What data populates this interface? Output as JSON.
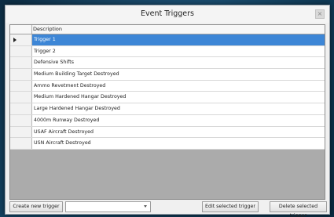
{
  "window": {
    "title": "Event Triggers",
    "close_glyph": "×"
  },
  "grid": {
    "column_header": "Description",
    "selected_index": 0,
    "rows": [
      "Trigger 1",
      "Trigger 2",
      "Defensive Shifts",
      "Medium Building Target Destroyed",
      "Ammo Revetment Destroyed",
      "Medium Hardened Hangar Destroyed",
      "Large Hardened Hangar Destroyed",
      "4000m Runway Destroyed",
      "USAF Aircraft Destroyed",
      "USN Aircraft Destroyed"
    ]
  },
  "buttons": {
    "create": "Create new trigger",
    "edit": "Edit selected trigger",
    "delete": "Delete selected trigger"
  },
  "combo": {
    "value": ""
  },
  "colors": {
    "selection": "#3d86d6",
    "dialog_bg": "#f0f0f0",
    "grid_bg": "#ababab"
  }
}
